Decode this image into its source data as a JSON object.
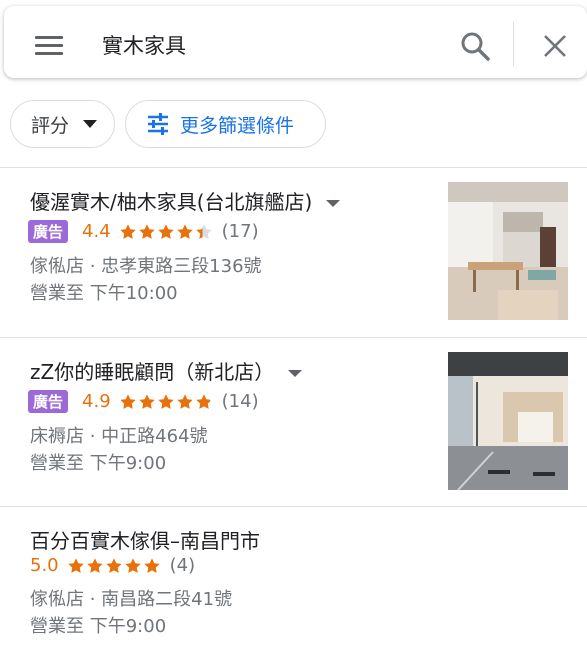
{
  "search": {
    "query": "實木家具"
  },
  "filters": {
    "rating_label": "評分",
    "more_label": "更多篩選條件"
  },
  "colors": {
    "accent": "#1a73e8",
    "star": "#e8710a",
    "ad_badge": "#9c6ad6"
  },
  "results": [
    {
      "title": "優渥實木/柚木家具(台北旗艦店)",
      "ad_label": "廣告",
      "rating": "4.4",
      "rating_value": 4.4,
      "reviews": "(17)",
      "category_address": "傢俬店 · 忠孝東路三段136號",
      "hours": "營業至 下午10:00",
      "has_thumbnail": true
    },
    {
      "title": "zZ你的睡眠顧問（新北店）",
      "ad_label": "廣告",
      "rating": "4.9",
      "rating_value": 4.9,
      "reviews": "(14)",
      "category_address": "床褥店 · 中正路464號",
      "hours": "營業至 下午9:00",
      "has_thumbnail": true
    },
    {
      "title": "百分百實木傢俱–南昌門市",
      "rating": "5.0",
      "rating_value": 5.0,
      "reviews": "(4)",
      "category_address": "傢俬店 · 南昌路二段41號",
      "hours": "營業至 下午9:00",
      "has_thumbnail": false
    }
  ]
}
